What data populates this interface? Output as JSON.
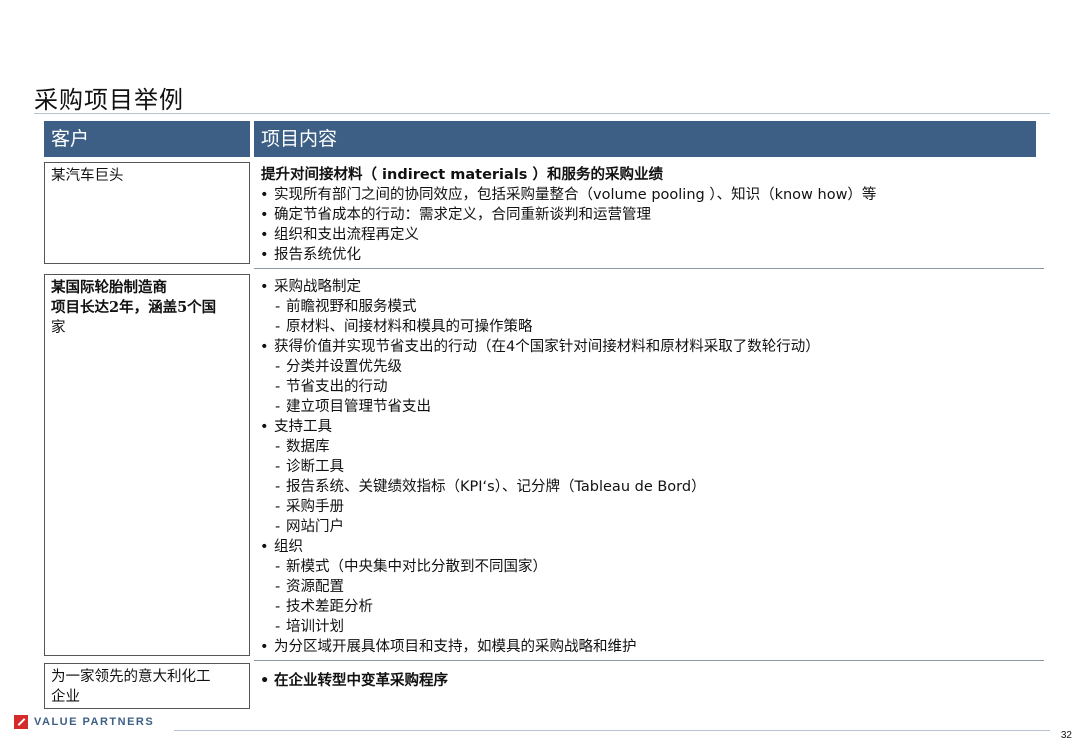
{
  "page_title": "采购项目举例",
  "table_header": {
    "client": "客户",
    "content": "项目内容"
  },
  "rows": [
    {
      "client_lines": [
        "某汽车巨头"
      ],
      "heading": "提升对间接材料（ indirect materials ）和服务的采购业绩",
      "items": [
        "实现所有部门之间的协同效应，包括采购量整合（volume pooling ）、知识（know how）等",
        "确定节省成本的行动：需求定义，合同重新谈判和运营管理",
        "组织和支出流程再定义",
        "报告系统优化"
      ]
    },
    {
      "client_lines": [
        "某国际轮胎制造商",
        "项目长达2年，涵盖5个国",
        "家"
      ],
      "groups": [
        {
          "label": "采购战略制定",
          "subs": [
            "前瞻视野和服务模式",
            "原材料、间接材料和模具的可操作策略"
          ]
        },
        {
          "label": "获得价值并实现节省支出的行动（在4个国家针对间接材料和原材料采取了数轮行动）",
          "subs": [
            "分类并设置优先级",
            "节省支出的行动",
            "建立项目管理节省支出"
          ]
        },
        {
          "label": "支持工具",
          "subs": [
            "数据库",
            "诊断工具",
            "报告系统、关键绩效指标（KPI‘s）、记分牌（Tableau de Bord）",
            "采购手册",
            "网站门户"
          ]
        },
        {
          "label": "组织",
          "subs": [
            "新模式（中央集中对比分散到不同国家）",
            "资源配置",
            "技术差距分析",
            "培训计划"
          ]
        },
        {
          "label": "为分区域开展具体项目和支持，如模具的采购战略和维护",
          "subs": []
        }
      ]
    },
    {
      "client_lines": [
        "为一家领先的意大利化工",
        "企业"
      ],
      "items": [
        "在企业转型中变革采购程序"
      ]
    }
  ],
  "footer": {
    "logo_text": "VALUE PARTNERS",
    "page_number": "32"
  },
  "colors": {
    "header_bg": "#3d5f85",
    "logo_red": "#d42a2a"
  }
}
